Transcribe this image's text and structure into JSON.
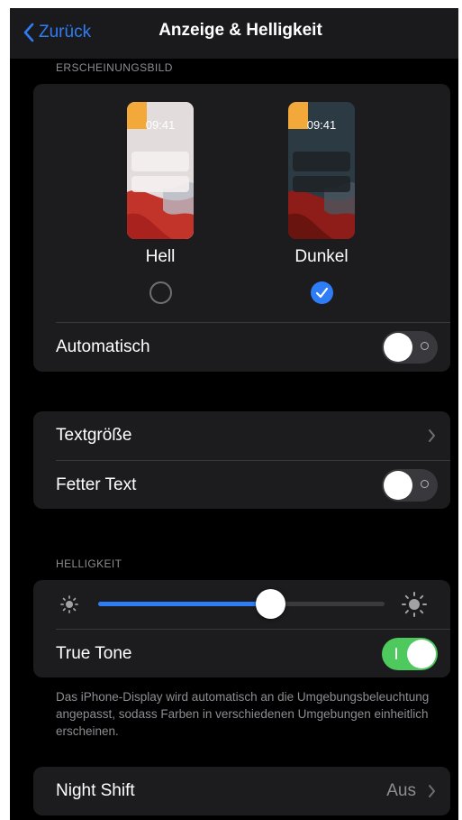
{
  "nav": {
    "back_label": "Zurück",
    "title": "Anzeige & Helligkeit"
  },
  "appearance": {
    "header": "ERSCHEINUNGSBILD",
    "options": [
      {
        "label": "Hell",
        "time": "09:41",
        "selected": false
      },
      {
        "label": "Dunkel",
        "time": "09:41",
        "selected": true
      }
    ],
    "automatic": {
      "label": "Automatisch",
      "on": false
    }
  },
  "text": {
    "text_size_label": "Textgröße",
    "bold_text": {
      "label": "Fetter Text",
      "on": false
    }
  },
  "brightness": {
    "header": "HELLIGKEIT",
    "level": 0.6,
    "true_tone": {
      "label": "True Tone",
      "on": true
    },
    "footer": "Das iPhone-Display wird automatisch an die Umgebungsbeleuchtung angepasst, sodass Farben in verschiedenen Umgebungen einheitlich erscheinen."
  },
  "night_shift": {
    "label": "Night Shift",
    "value": "Aus"
  },
  "colors": {
    "accent": "#2f7df6",
    "toggle_on": "#4dc95e",
    "group_bg": "#1c1c1e",
    "background": "#000000"
  },
  "icons": {
    "back": "chevron-left-icon",
    "disclosure": "chevron-right-icon",
    "brightness_low": "sun-small-icon",
    "brightness_high": "sun-large-icon",
    "selected": "checkmark-icon"
  }
}
